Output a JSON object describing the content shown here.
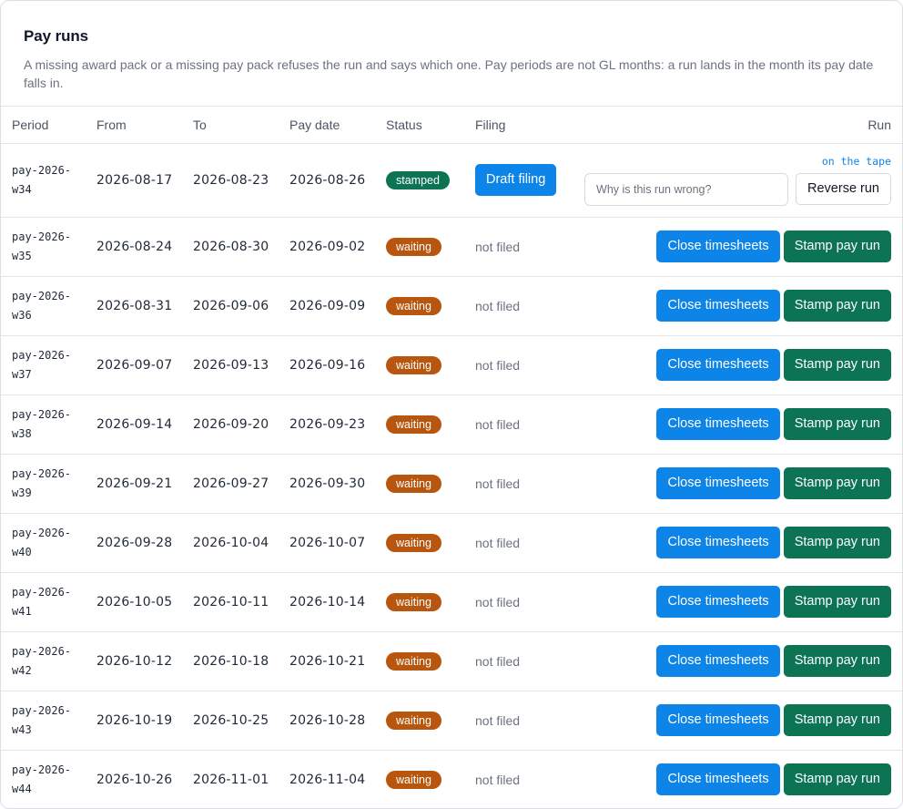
{
  "header": {
    "title": "Pay runs",
    "description": "A missing award pack or a missing pay pack refuses the run and says which one. Pay periods are not GL months: a run lands in the month its pay date falls in."
  },
  "columns": {
    "period": "Period",
    "from": "From",
    "to": "To",
    "pay_date": "Pay date",
    "status": "Status",
    "filing": "Filing",
    "run": "Run"
  },
  "first_row": {
    "period": "pay-2026-w34",
    "from": "2026-08-17",
    "to": "2026-08-23",
    "pay_date": "2026-08-26",
    "status": "stamped",
    "filing_button": "Draft filing",
    "tape_link": "on the tape",
    "reason_placeholder": "Why is this run wrong?",
    "reverse_button": "Reverse run"
  },
  "rows": [
    {
      "period": "pay-2026-w35",
      "from": "2026-08-24",
      "to": "2026-08-30",
      "pay_date": "2026-09-02",
      "status": "waiting",
      "filing": "not filed",
      "close_label": "Close timesheets",
      "stamp_label": "Stamp pay run"
    },
    {
      "period": "pay-2026-w36",
      "from": "2026-08-31",
      "to": "2026-09-06",
      "pay_date": "2026-09-09",
      "status": "waiting",
      "filing": "not filed",
      "close_label": "Close timesheets",
      "stamp_label": "Stamp pay run"
    },
    {
      "period": "pay-2026-w37",
      "from": "2026-09-07",
      "to": "2026-09-13",
      "pay_date": "2026-09-16",
      "status": "waiting",
      "filing": "not filed",
      "close_label": "Close timesheets",
      "stamp_label": "Stamp pay run"
    },
    {
      "period": "pay-2026-w38",
      "from": "2026-09-14",
      "to": "2026-09-20",
      "pay_date": "2026-09-23",
      "status": "waiting",
      "filing": "not filed",
      "close_label": "Close timesheets",
      "stamp_label": "Stamp pay run"
    },
    {
      "period": "pay-2026-w39",
      "from": "2026-09-21",
      "to": "2026-09-27",
      "pay_date": "2026-09-30",
      "status": "waiting",
      "filing": "not filed",
      "close_label": "Close timesheets",
      "stamp_label": "Stamp pay run"
    },
    {
      "period": "pay-2026-w40",
      "from": "2026-09-28",
      "to": "2026-10-04",
      "pay_date": "2026-10-07",
      "status": "waiting",
      "filing": "not filed",
      "close_label": "Close timesheets",
      "stamp_label": "Stamp pay run"
    },
    {
      "period": "pay-2026-w41",
      "from": "2026-10-05",
      "to": "2026-10-11",
      "pay_date": "2026-10-14",
      "status": "waiting",
      "filing": "not filed",
      "close_label": "Close timesheets",
      "stamp_label": "Stamp pay run"
    },
    {
      "period": "pay-2026-w42",
      "from": "2026-10-12",
      "to": "2026-10-18",
      "pay_date": "2026-10-21",
      "status": "waiting",
      "filing": "not filed",
      "close_label": "Close timesheets",
      "stamp_label": "Stamp pay run"
    },
    {
      "period": "pay-2026-w43",
      "from": "2026-10-19",
      "to": "2026-10-25",
      "pay_date": "2026-10-28",
      "status": "waiting",
      "filing": "not filed",
      "close_label": "Close timesheets",
      "stamp_label": "Stamp pay run"
    },
    {
      "period": "pay-2026-w44",
      "from": "2026-10-26",
      "to": "2026-11-01",
      "pay_date": "2026-11-04",
      "status": "waiting",
      "filing": "not filed",
      "close_label": "Close timesheets",
      "stamp_label": "Stamp pay run"
    }
  ],
  "colors": {
    "primary": "#0d84e8",
    "stamp_green": "#0c7353",
    "waiting_orange": "#b8560f"
  }
}
